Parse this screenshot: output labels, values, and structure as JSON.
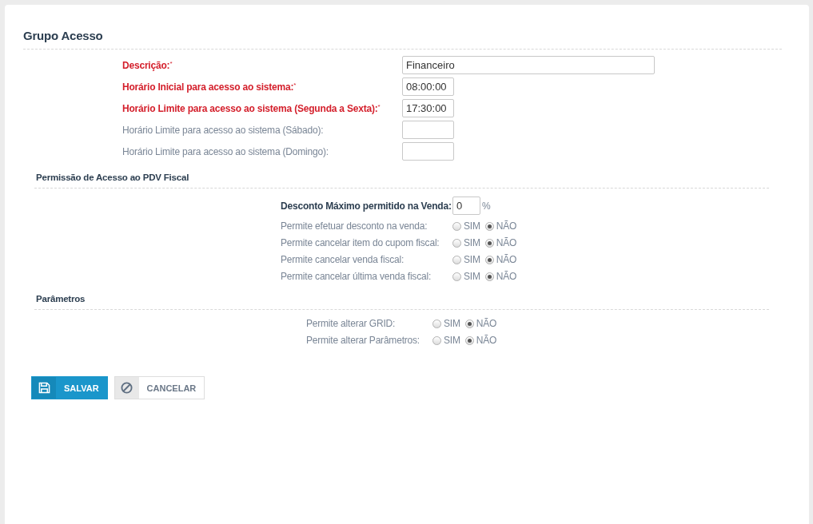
{
  "title": "Grupo Acesso",
  "fields": [
    {
      "label": "Descrição:",
      "required": true,
      "mark": "*",
      "value": "Financeiro",
      "kind": "wide"
    },
    {
      "label": "Horário Inicial para acesso ao sistema:",
      "required": true,
      "mark": "*",
      "value": "08:00:00",
      "kind": "short"
    },
    {
      "label": "Horário Limite para acesso ao sistema (Segunda a Sexta):",
      "required": true,
      "mark": "*",
      "value": "17:30:00",
      "kind": "short"
    },
    {
      "label": "Horário Limite para acesso ao sistema (Sábado):",
      "required": false,
      "kind": "short"
    },
    {
      "label": "Horário Limite para acesso ao sistema (Domingo):",
      "required": false,
      "kind": "short"
    }
  ],
  "sections": [
    {
      "title": "Permissão de Acesso ao PDV Fiscal",
      "rows": [
        {
          "kind": "input",
          "label": "Desconto Máximo permitido na Venda:",
          "value": "0",
          "unit": "%"
        },
        {
          "kind": "radio",
          "label": "Permite efetuar desconto na venda:",
          "options": [
            {
              "label": "SIM",
              "selected": false
            },
            {
              "label": "NÃO",
              "selected": true
            }
          ]
        },
        {
          "kind": "radio",
          "label": "Permite cancelar item do cupom fiscal:",
          "options": [
            {
              "label": "SIM",
              "selected": false
            },
            {
              "label": "NÃO",
              "selected": true
            }
          ]
        },
        {
          "kind": "radio",
          "label": "Permite cancelar venda fiscal:",
          "options": [
            {
              "label": "SIM",
              "selected": false
            },
            {
              "label": "NÃO",
              "selected": true
            }
          ]
        },
        {
          "kind": "radio",
          "label": "Permite cancelar última venda fiscal:",
          "options": [
            {
              "label": "SIM",
              "selected": false
            },
            {
              "label": "NÃO",
              "selected": true
            }
          ]
        }
      ]
    },
    {
      "title": "Parâmetros",
      "rows": [
        {
          "kind": "radio",
          "label": "Permite alterar GRID:",
          "options": [
            {
              "label": "SIM",
              "selected": false
            },
            {
              "label": "NÃO",
              "selected": true
            }
          ]
        },
        {
          "kind": "radio",
          "label": "Permite alterar Parâmetros:",
          "options": [
            {
              "label": "SIM",
              "selected": false
            },
            {
              "label": "NÃO",
              "selected": true
            }
          ]
        }
      ]
    }
  ],
  "buttons": [
    {
      "kind": "save",
      "label": "SALVAR"
    },
    {
      "kind": "cancel",
      "label": "CANCELAR"
    }
  ]
}
